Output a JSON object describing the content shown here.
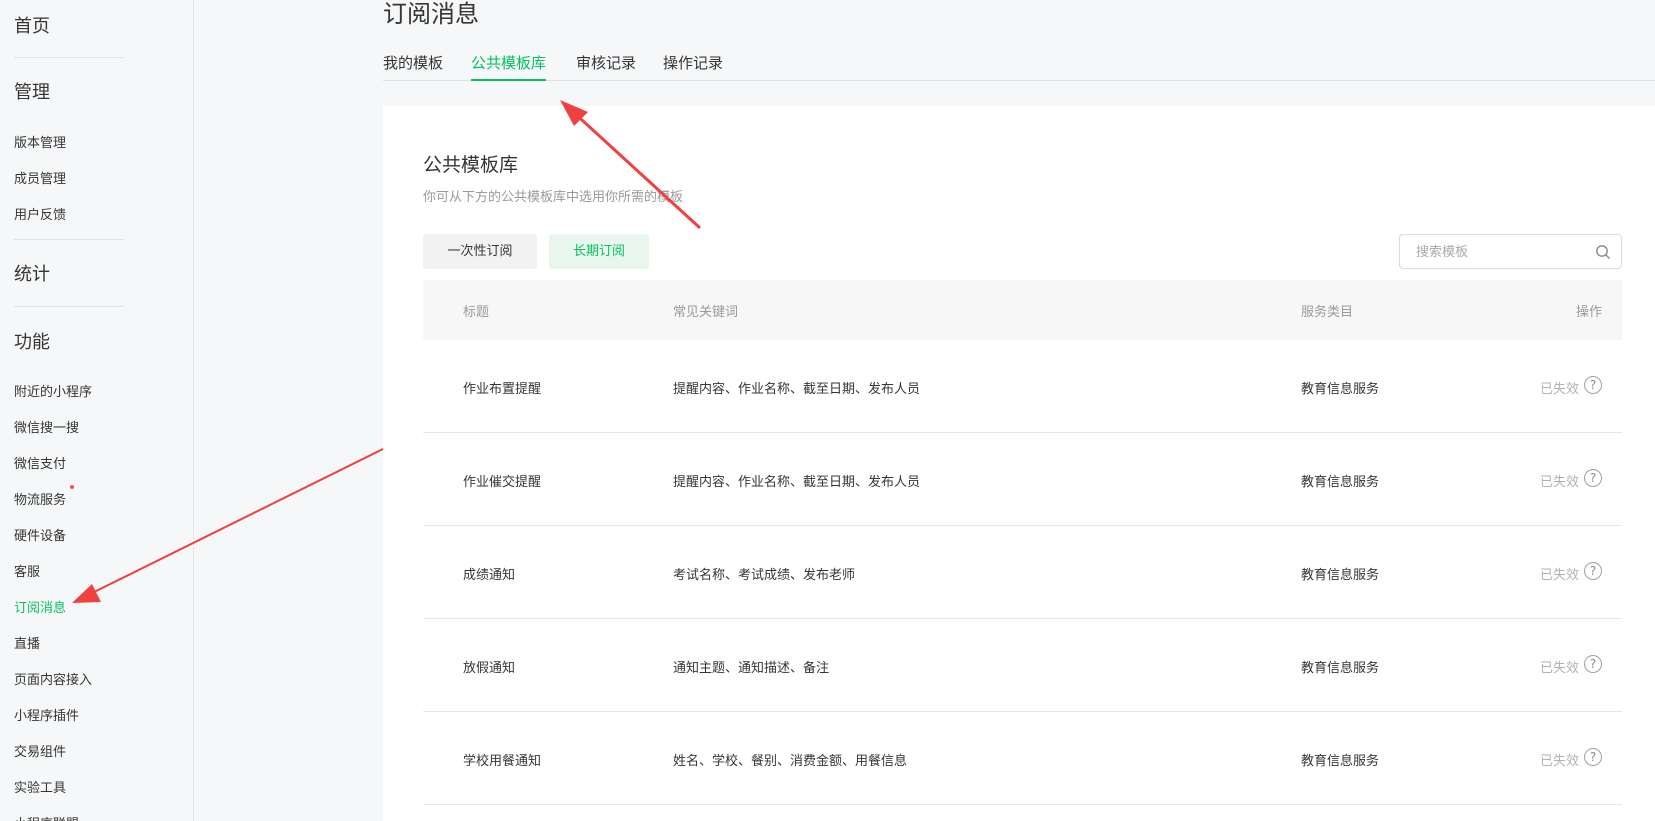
{
  "sidebar": {
    "home": "首页",
    "manage": {
      "title": "管理",
      "items": [
        "版本管理",
        "成员管理",
        "用户反馈"
      ]
    },
    "stats": {
      "title": "统计"
    },
    "features": {
      "title": "功能",
      "items": [
        "附近的小程序",
        "微信搜一搜",
        "微信支付",
        "物流服务",
        "硬件设备",
        "客服",
        "订阅消息",
        "直播",
        "页面内容接入",
        "小程序插件",
        "交易组件",
        "实验工具",
        "小程序联盟"
      ],
      "active": "订阅消息"
    }
  },
  "page": {
    "title": "订阅消息"
  },
  "tabs": [
    "我的模板",
    "公共模板库",
    "审核记录",
    "操作记录"
  ],
  "active_tab": "公共模板库",
  "card": {
    "title": "公共模板库",
    "description": "你可从下方的公共模板库中选用你所需的模板",
    "filters": {
      "one_time": "一次性订阅",
      "long_term": "长期订阅"
    },
    "search_placeholder": "搜索模板"
  },
  "table": {
    "headers": {
      "title": "标题",
      "keywords": "常见关键词",
      "category": "服务类目",
      "action": "操作"
    },
    "rows": [
      {
        "title": "作业布置提醒",
        "keywords": "提醒内容、作业名称、截至日期、发布人员",
        "category": "教育信息服务",
        "status": "已失效"
      },
      {
        "title": "作业催交提醒",
        "keywords": "提醒内容、作业名称、截至日期、发布人员",
        "category": "教育信息服务",
        "status": "已失效"
      },
      {
        "title": "成绩通知",
        "keywords": "考试名称、考试成绩、发布老师",
        "category": "教育信息服务",
        "status": "已失效"
      },
      {
        "title": "放假通知",
        "keywords": "通知主题、通知描述、备注",
        "category": "教育信息服务",
        "status": "已失效"
      },
      {
        "title": "学校用餐通知",
        "keywords": "姓名、学校、餐别、消费金额、用餐信息",
        "category": "教育信息服务",
        "status": "已失效"
      }
    ],
    "help_glyph": "?"
  },
  "colors": {
    "accent": "#07c160",
    "annotation": "#f04040"
  }
}
